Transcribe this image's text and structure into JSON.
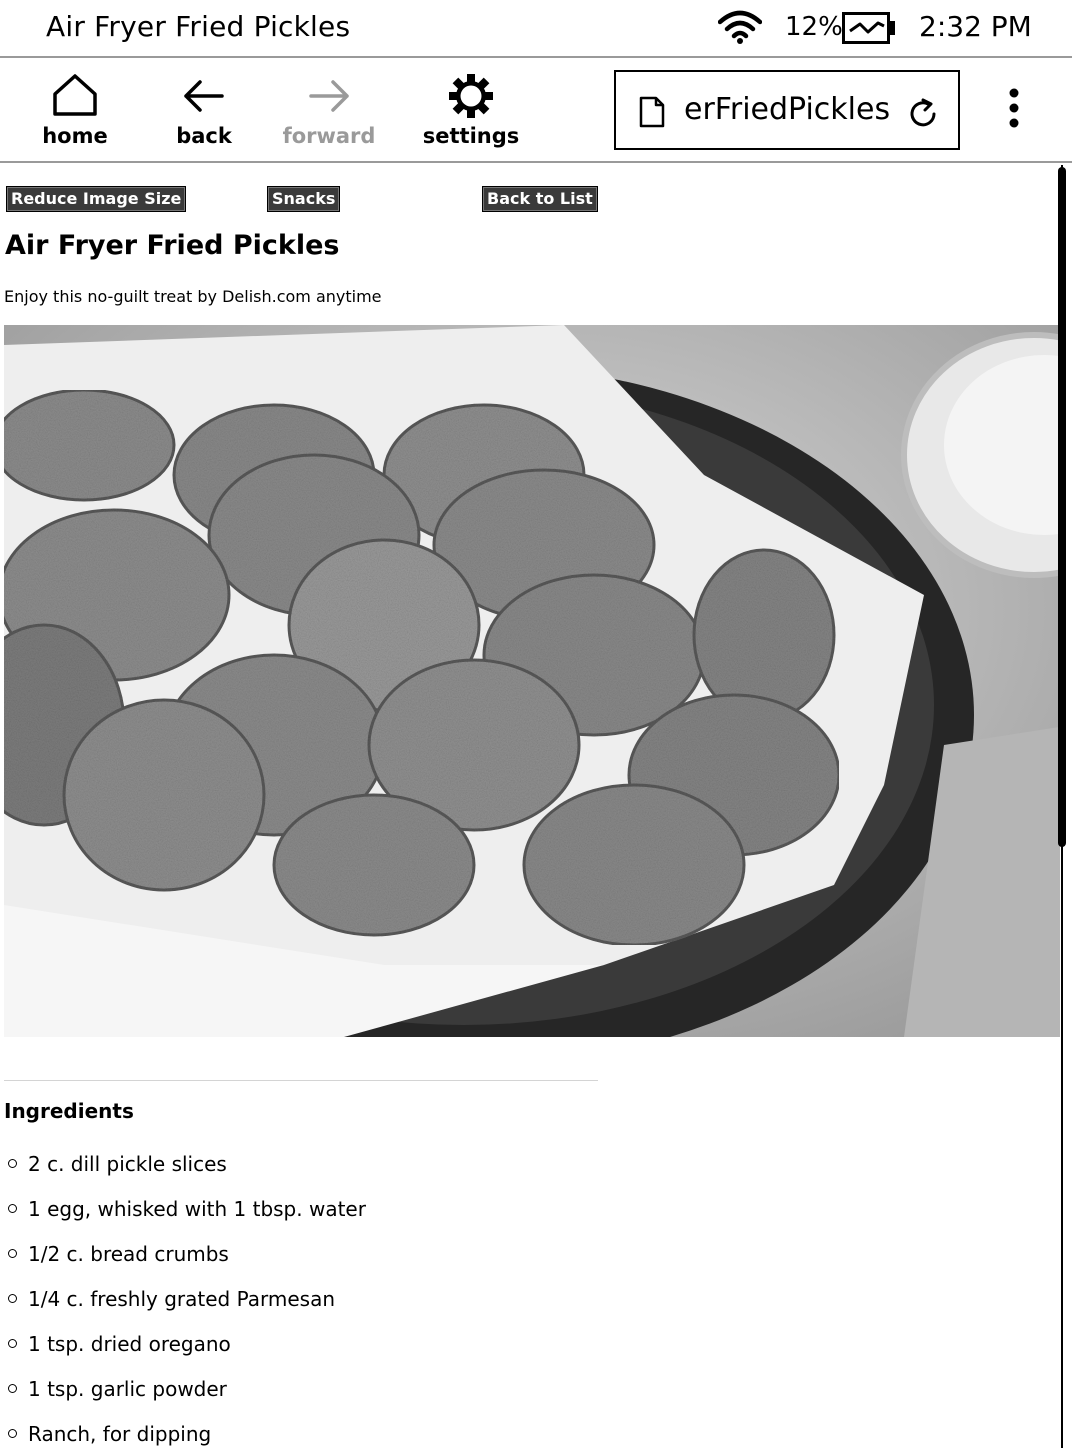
{
  "status_bar": {
    "title": "Air Fryer Fried Pickles",
    "battery_percent": "12%",
    "battery_charging": true,
    "time": "2:32 PM",
    "icons": [
      "wifi-icon",
      "battery-charging-icon"
    ]
  },
  "toolbar": {
    "home_label": "home",
    "back_label": "back",
    "forward_label": "forward",
    "forward_enabled": false,
    "settings_label": "settings",
    "url_text": "erFriedPickles",
    "icons": [
      "home-icon",
      "back-arrow-icon",
      "forward-arrow-icon",
      "settings-gear-icon",
      "page-icon",
      "reload-icon",
      "more-menu-icon"
    ]
  },
  "page": {
    "buttons": {
      "reduce_image": "Reduce Image Size",
      "category": "Snacks",
      "back_to_list": "Back to List"
    },
    "title": "Air Fryer Fried Pickles",
    "subtitle": "Enjoy this no-guilt treat by Delish.com anytime",
    "ingredients_heading": "Ingredients",
    "ingredients": [
      "2 c. dill pickle slices",
      "1 egg, whisked with 1 tbsp. water",
      "1/2 c. bread crumbs",
      "1/4 c. freshly grated Parmesan",
      "1 tsp. dried oregano",
      "1 tsp. garlic powder",
      "Ranch, for dipping"
    ]
  },
  "scroll": {
    "position_fraction": 0.0,
    "visible_fraction": 0.53
  }
}
